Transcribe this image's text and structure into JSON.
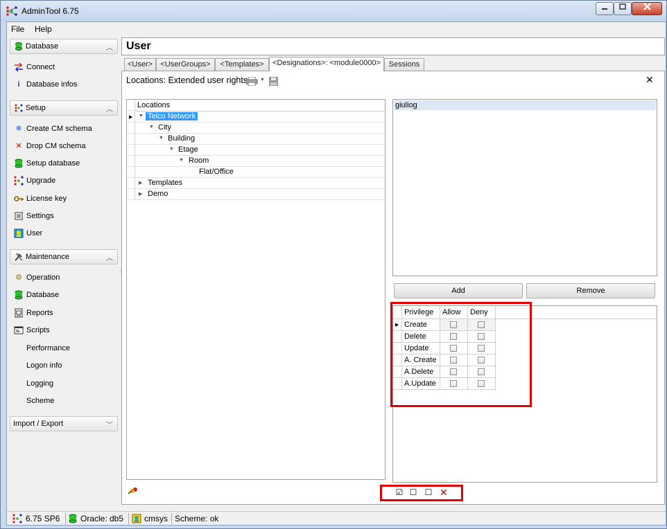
{
  "window": {
    "title": "AdminTool 6.75"
  },
  "menu": {
    "file": "File",
    "help": "Help"
  },
  "sidebar": {
    "groups": [
      {
        "label": "Database",
        "expanded": true,
        "items": [
          "Connect",
          "Database infos"
        ]
      },
      {
        "label": "Setup",
        "expanded": true,
        "items": [
          "Create CM schema",
          "Drop CM schema",
          "Setup database",
          "Upgrade",
          "License key",
          "Settings",
          "User"
        ]
      },
      {
        "label": "Maintenance",
        "expanded": true,
        "items": [
          "Operation",
          "Database",
          "Reports",
          "Scripts",
          "Performance",
          "Logon info",
          "Logging",
          "Scheme"
        ]
      },
      {
        "label": "Import / Export",
        "expanded": false,
        "items": []
      }
    ]
  },
  "main": {
    "title": "User",
    "tabs": [
      {
        "label": "<User>",
        "active": false
      },
      {
        "label": "<UserGroups>",
        "active": false
      },
      {
        "label": "<Templates>",
        "active": false
      },
      {
        "label": "<Designations>: <module0000>",
        "active": true
      },
      {
        "label": "Sessions",
        "active": false
      }
    ],
    "panel_title": "Locations: Extended user rights",
    "close_glyph": "✕"
  },
  "locations": {
    "header": "Locations",
    "rows": [
      {
        "label": "Telco Network",
        "level": 0,
        "expanded": true,
        "selected": true
      },
      {
        "label": "City",
        "level": 1,
        "expanded": true,
        "selected": false
      },
      {
        "label": "Building",
        "level": 2,
        "expanded": true,
        "selected": false
      },
      {
        "label": "Etage",
        "level": 3,
        "expanded": true,
        "selected": false
      },
      {
        "label": "Room",
        "level": 4,
        "expanded": true,
        "selected": false
      },
      {
        "label": "Flat/Office",
        "level": 5,
        "expanded": null,
        "selected": false
      },
      {
        "label": "Templates",
        "level": 0,
        "expanded": false,
        "selected": false
      },
      {
        "label": "Demo",
        "level": 0,
        "expanded": false,
        "selected": false
      }
    ]
  },
  "users": {
    "items": [
      "giuliog"
    ]
  },
  "buttons": {
    "add": "Add",
    "remove": "Remove"
  },
  "privileges": {
    "headers": [
      "Privilege",
      "Allow",
      "Deny"
    ],
    "rows": [
      {
        "name": "Create",
        "allow": false,
        "deny": false
      },
      {
        "name": "Delete",
        "allow": false,
        "deny": false
      },
      {
        "name": "Update",
        "allow": false,
        "deny": false
      },
      {
        "name": "A. Create",
        "allow": false,
        "deny": false
      },
      {
        "name": "A.Delete",
        "allow": false,
        "deny": false
      },
      {
        "name": "A.Update",
        "allow": false,
        "deny": false
      }
    ]
  },
  "bottom_toolbar": {
    "check": "☑",
    "uncheck": "☐",
    "blank": "☐",
    "delete": "✕"
  },
  "status": {
    "version": "6.75 SP6",
    "db": "Oracle: db5",
    "user": "cmsys",
    "scheme": "Scheme: ok"
  },
  "colors": {
    "accent": "#3399ff",
    "highlight": "#e00000"
  }
}
